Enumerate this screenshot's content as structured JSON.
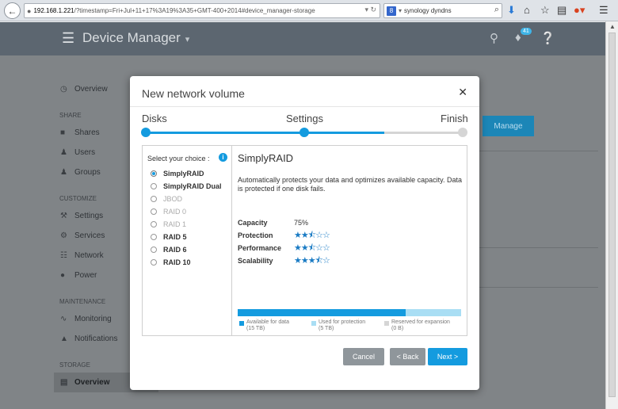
{
  "browser": {
    "url_host": "192.168.1.221",
    "url_path": "/?timestamp=Fri+Jul+11+17%3A19%3A35+GMT-400+2014#device_manager-storage",
    "search_text": "synology dyndns",
    "badge_count": "41"
  },
  "header": {
    "title": "Device Manager"
  },
  "sidebar": {
    "overview": "Overview",
    "share_section": "SHARE",
    "shares": "Shares",
    "users": "Users",
    "groups": "Groups",
    "customize_section": "CUSTOMIZE",
    "settings": "Settings",
    "services": "Services",
    "network": "Network",
    "power": "Power",
    "maintenance_section": "MAINTENANCE",
    "monitoring": "Monitoring",
    "notifications": "Notifications",
    "storage_section": "STORAGE",
    "storage_overview": "Overview"
  },
  "background": {
    "manage_button": "Manage"
  },
  "modal": {
    "title": "New network volume",
    "steps": [
      "Disks",
      "Settings",
      "Finish"
    ],
    "progress_fraction": 0.75,
    "choice_label": "Select your choice :",
    "options": [
      {
        "label": "SimplyRAID",
        "selected": true,
        "enabled": true
      },
      {
        "label": "SimplyRAID Dual",
        "selected": false,
        "enabled": true
      },
      {
        "label": "JBOD",
        "selected": false,
        "enabled": false
      },
      {
        "label": "RAID 0",
        "selected": false,
        "enabled": false
      },
      {
        "label": "RAID 1",
        "selected": false,
        "enabled": false
      },
      {
        "label": "RAID 5",
        "selected": false,
        "enabled": true
      },
      {
        "label": "RAID 6",
        "selected": false,
        "enabled": true
      },
      {
        "label": "RAID 10",
        "selected": false,
        "enabled": true
      }
    ],
    "detail": {
      "title": "SimplyRAID",
      "description": "Automatically protects your data and optimizes available capacity. Data is protected if one disk fails.",
      "capacity_label": "Capacity",
      "capacity_value": "75%",
      "protection_label": "Protection",
      "protection_stars": 2.5,
      "performance_label": "Performance",
      "performance_stars": 2.5,
      "scalability_label": "Scalability",
      "scalability_stars": 3.5,
      "capacity_bar_fraction": 0.75,
      "legend": [
        {
          "label": "Available for data",
          "value": "(15 TB)",
          "color": "#149bdf"
        },
        {
          "label": "Used for protection",
          "value": "(5 TB)",
          "color": "#a9def4"
        },
        {
          "label": "Reserved for expansion",
          "value": "(0 B)",
          "color": "#d5d5d5"
        }
      ]
    },
    "buttons": {
      "cancel": "Cancel",
      "back": "< Back",
      "next": "Next >"
    }
  },
  "colors": {
    "accent": "#149bdf",
    "header_bg": "#5c6670"
  }
}
